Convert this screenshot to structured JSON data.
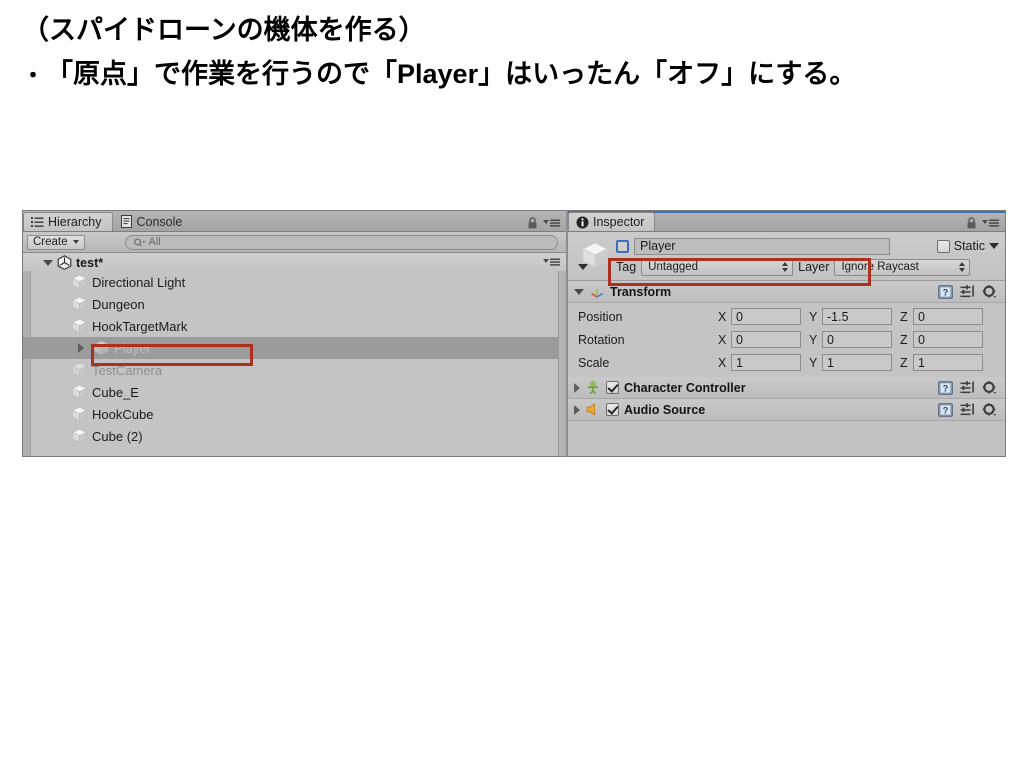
{
  "slide": {
    "line1": "（スパイドローンの機体を作る）",
    "bullet": "・",
    "line2": "「原点」で作業を行うので「Player」はいったん「オフ」にする。"
  },
  "hierarchy": {
    "tabs": [
      {
        "label": "Hierarchy",
        "icon": "hierarchy-list-icon",
        "selected": true
      },
      {
        "label": "Console",
        "icon": "console-icon",
        "selected": false
      }
    ],
    "toolbar": {
      "create_label": "Create",
      "search_placeholder": "All",
      "search_icon": "search-icon"
    },
    "scene": {
      "name": "test*",
      "icon": "unity-logo-icon",
      "expanded": true
    },
    "items": [
      {
        "label": "Directional Light",
        "disabled": false,
        "selected": false,
        "expandable": false
      },
      {
        "label": "Dungeon",
        "disabled": false,
        "selected": false,
        "expandable": false
      },
      {
        "label": "HookTargetMark",
        "disabled": false,
        "selected": false,
        "expandable": false
      },
      {
        "label": "Player",
        "disabled": true,
        "selected": true,
        "expandable": true
      },
      {
        "label": "TestCamera",
        "disabled": true,
        "selected": false,
        "expandable": false
      },
      {
        "label": "Cube_E",
        "disabled": false,
        "selected": false,
        "expandable": false
      },
      {
        "label": "HookCube",
        "disabled": false,
        "selected": false,
        "expandable": false
      },
      {
        "label": "Cube (2)",
        "disabled": false,
        "selected": false,
        "expandable": false
      }
    ],
    "lock_icon": "lock-icon",
    "menu_icon": "hamburger-menu-icon"
  },
  "inspector": {
    "tab_label": "Inspector",
    "tab_icon": "info-icon",
    "lock_icon": "lock-icon",
    "menu_icon": "hamburger-menu-icon",
    "gameobject": {
      "enabled": false,
      "name": "Player",
      "static_label": "Static",
      "static_checked": false,
      "tag_label": "Tag",
      "tag_value": "Untagged",
      "layer_label": "Layer",
      "layer_value": "Ignore Raycast"
    },
    "components": [
      {
        "title": "Transform",
        "icon": "transform-axis-icon",
        "expanded": true,
        "has_checkbox": false,
        "rows": [
          {
            "label": "Position",
            "x": "0",
            "y": "-1.5",
            "z": "0"
          },
          {
            "label": "Rotation",
            "x": "0",
            "y": "0",
            "z": "0"
          },
          {
            "label": "Scale",
            "x": "1",
            "y": "1",
            "z": "1"
          }
        ]
      },
      {
        "title": "Character Controller",
        "icon": "character-controller-icon",
        "expanded": false,
        "has_checkbox": true,
        "checked": true
      },
      {
        "title": "Audio Source",
        "icon": "audio-source-icon",
        "expanded": false,
        "has_checkbox": true,
        "checked": true
      }
    ],
    "axis_labels": {
      "x": "X",
      "y": "Y",
      "z": "Z"
    },
    "row_icons": {
      "help": "help-book-icon",
      "preset": "preset-sliders-icon",
      "gear": "gear-icon"
    }
  },
  "annotations": {
    "color": "#ad2f1d",
    "boxes": [
      "hierarchy-player-row",
      "inspector-name-field"
    ]
  }
}
